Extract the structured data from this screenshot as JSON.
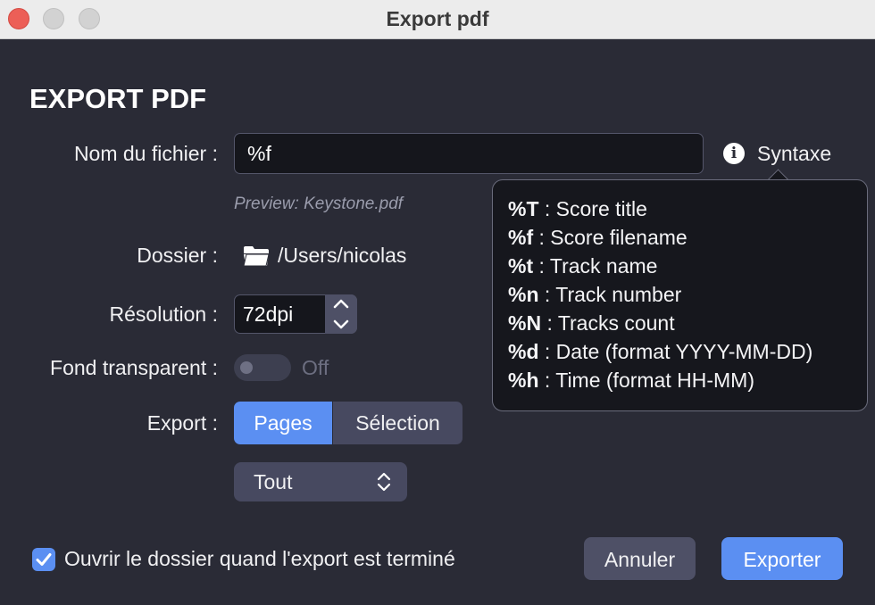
{
  "window": {
    "title": "Export pdf"
  },
  "heading": "EXPORT PDF",
  "filename": {
    "label": "Nom du fichier :",
    "value": "%f",
    "syntax_label": "Syntaxe",
    "info_icon_glyph": "i",
    "preview": "Preview: Keystone.pdf"
  },
  "folder": {
    "label": "Dossier :",
    "path": "/Users/nicolas"
  },
  "resolution": {
    "label": "Résolution :",
    "value": "72dpi"
  },
  "transparent": {
    "label": "Fond transparent :",
    "state": "Off"
  },
  "export": {
    "label": "Export :",
    "segments": [
      "Pages",
      "Sélection"
    ],
    "selected": "Pages",
    "range_value": "Tout"
  },
  "open_folder": {
    "label": "Ouvrir le dossier quand l'export est terminé",
    "checked": true
  },
  "buttons": {
    "cancel": "Annuler",
    "export": "Exporter"
  },
  "syntax_help": [
    {
      "code": "%T",
      "desc": " : Score title"
    },
    {
      "code": "%f",
      "desc": " : Score filename"
    },
    {
      "code": "%t",
      "desc": " : Track name"
    },
    {
      "code": "%n",
      "desc": " : Track number"
    },
    {
      "code": "%N",
      "desc": " : Tracks count"
    },
    {
      "code": "%d",
      "desc": " : Date (format YYYY-MM-DD)"
    },
    {
      "code": "%h",
      "desc": " : Time (format HH-MM)"
    }
  ],
  "colors": {
    "accent": "#5b8ff2",
    "background": "#2a2b36",
    "close": "#ec5f57"
  }
}
